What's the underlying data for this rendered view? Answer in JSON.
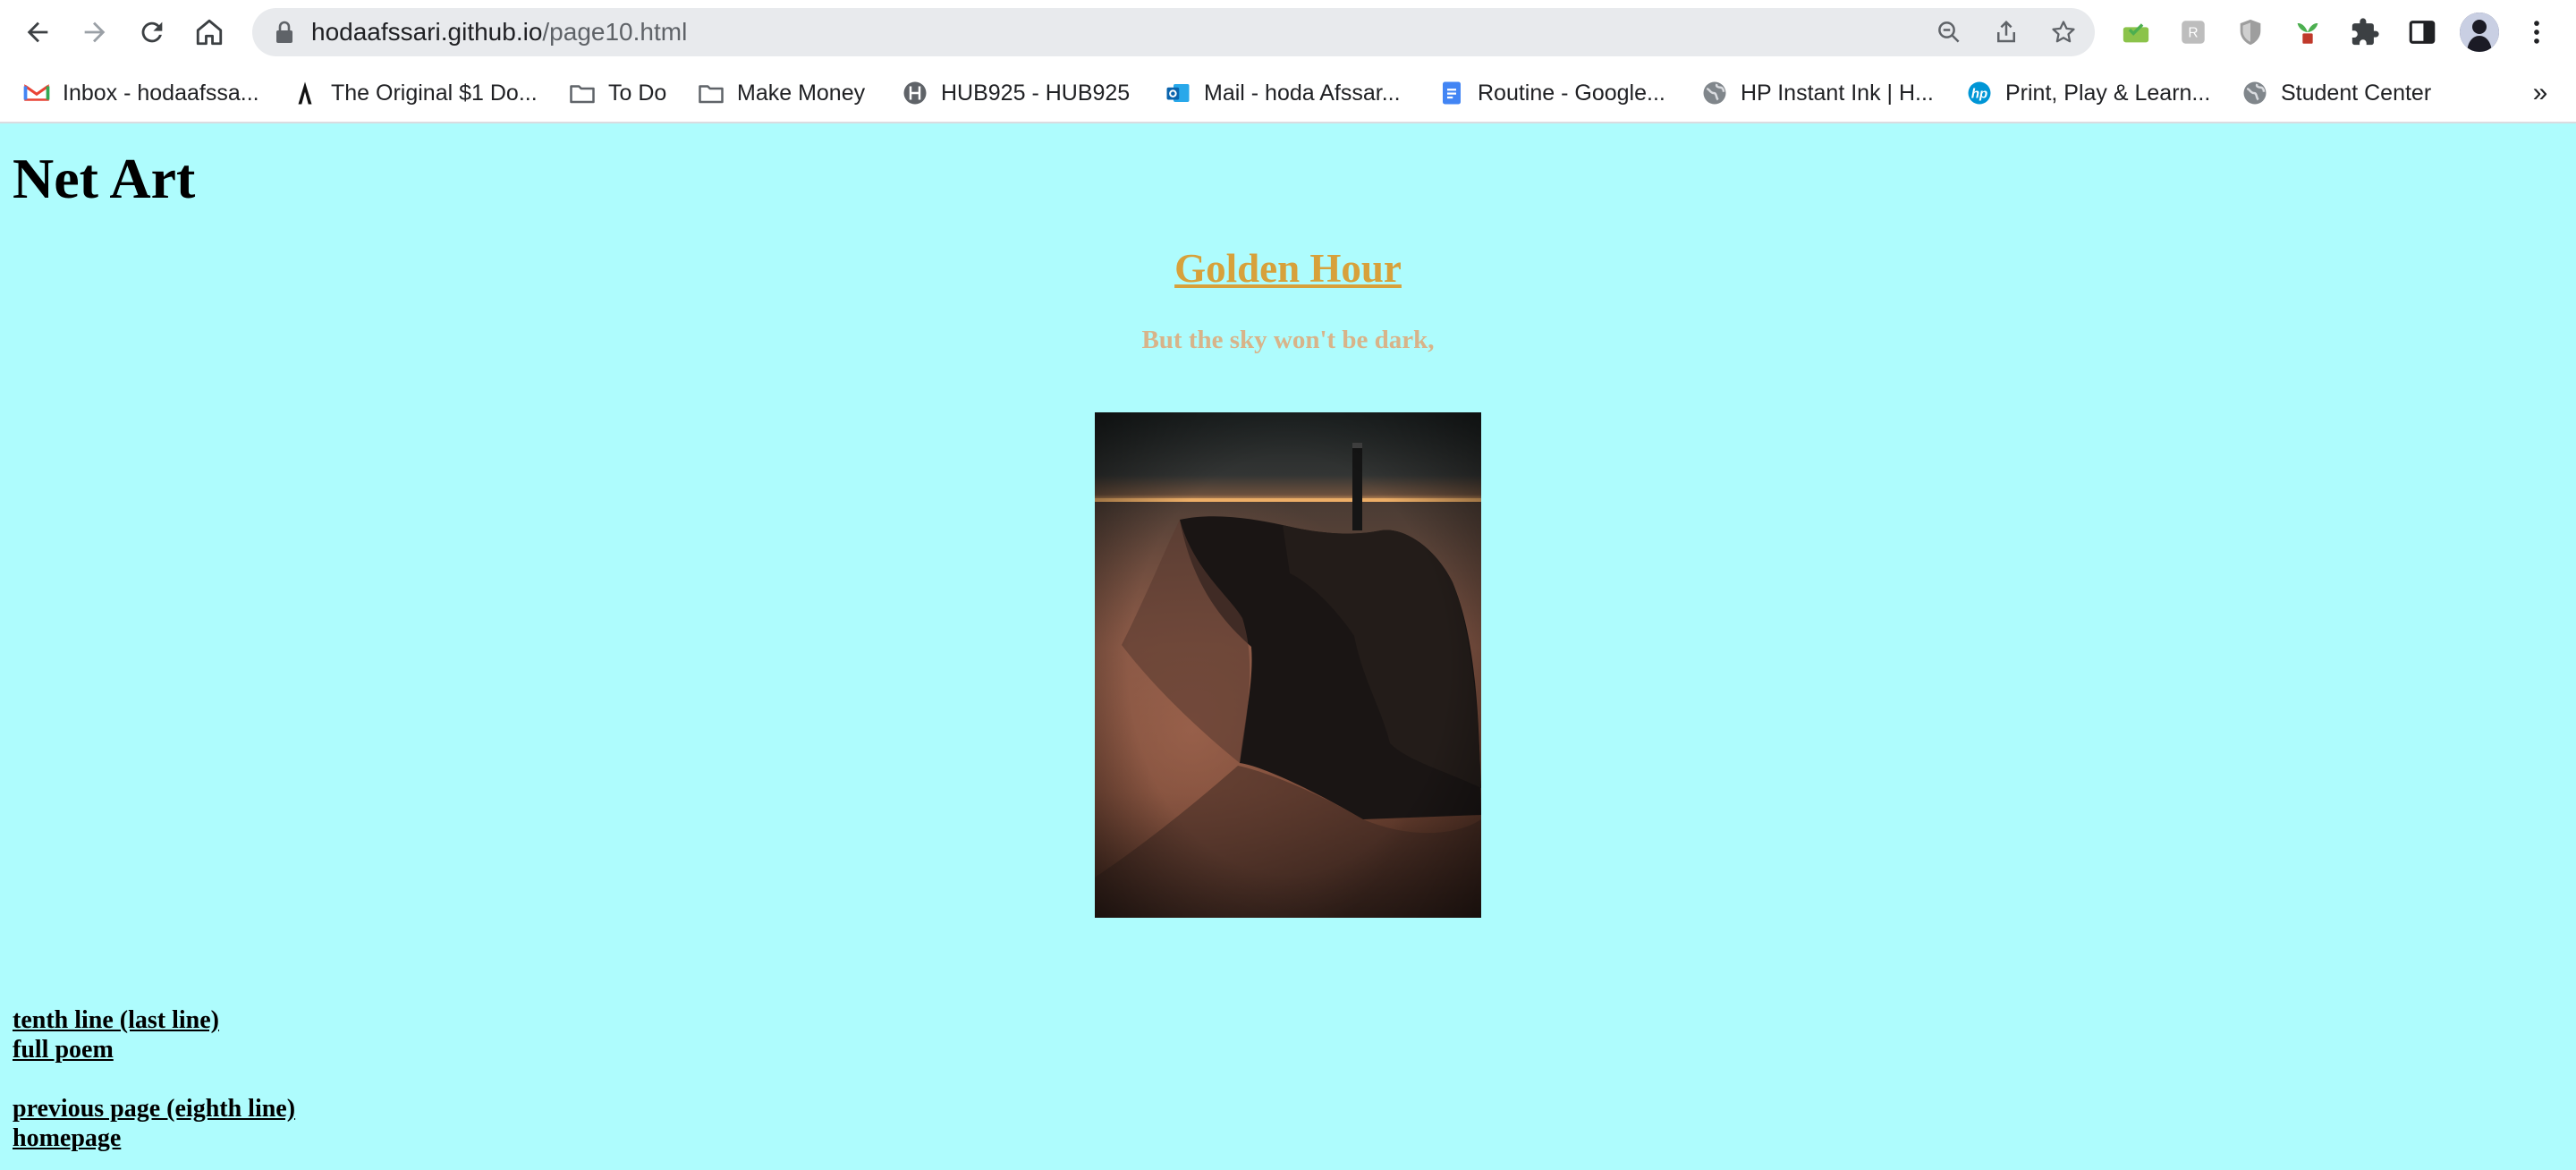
{
  "browser": {
    "url_host": "hodaafssari.github.io",
    "url_path": "/page10.html",
    "bookmarks": [
      {
        "label": "Inbox - hodaafssa...",
        "icon": "gmail-icon"
      },
      {
        "label": "The Original $1 Do...",
        "icon": "a-logo-icon"
      },
      {
        "label": "To Do",
        "icon": "folder-icon"
      },
      {
        "label": "Make Money",
        "icon": "folder-icon"
      },
      {
        "label": "HUB925 - HUB925",
        "icon": "hub-icon"
      },
      {
        "label": "Mail - hoda Afssar...",
        "icon": "outlook-icon"
      },
      {
        "label": "Routine - Google...",
        "icon": "google-docs-icon"
      },
      {
        "label": "HP Instant Ink | H...",
        "icon": "globe-icon"
      },
      {
        "label": "Print, Play & Learn...",
        "icon": "hp-icon"
      },
      {
        "label": "Student Center",
        "icon": "globe-icon"
      }
    ],
    "bookmarks_overflow": "»"
  },
  "page": {
    "heading": "Net Art",
    "poem_title": "Golden Hour",
    "poem_line": "But the sky won't be dark,",
    "links": {
      "next": "tenth line (last line)",
      "full": "full poem",
      "previous": "previous page (eighth line)",
      "home": "homepage"
    }
  },
  "colors": {
    "background": "#aefcfd",
    "title": "#d7a13b",
    "poem_line": "#d8b389"
  }
}
